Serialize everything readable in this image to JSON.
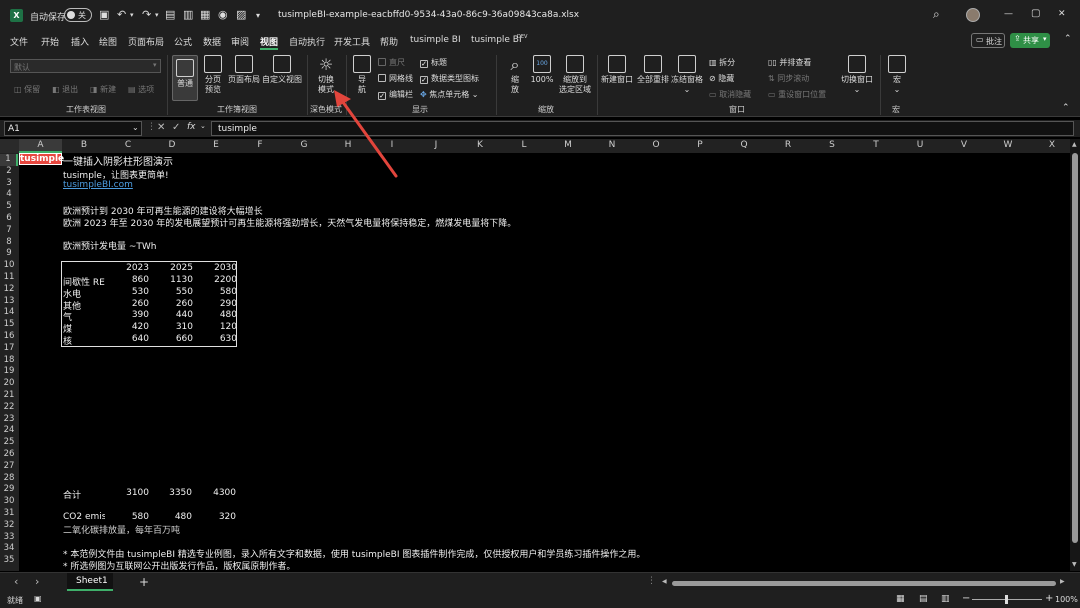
{
  "titlebar": {
    "autosave_label": "自动保存",
    "autosave_state": "关",
    "filename": "tusimpleBI-example-eacbffd0-9534-43a0-86c9-36a09843ca8a.xlsx",
    "win_min": "—",
    "win_max": "▢",
    "win_close": "✕"
  },
  "menu": {
    "items": [
      "文件",
      "开始",
      "插入",
      "绘图",
      "页面布局",
      "公式",
      "数据",
      "审阅",
      "视图",
      "自动执行",
      "开发工具",
      "帮助",
      "tusimple BI",
      "tusimple BI"
    ],
    "dev_badge": "DEV",
    "active_index": 8,
    "comment_label": "批注",
    "share_label": "共享"
  },
  "ribbon": {
    "sheetview": {
      "dropdown": "默认",
      "btn_keep": "保留",
      "btn_exit": "退出",
      "btn_new": "新建",
      "btn_options": "选项",
      "group": "工作表视图"
    },
    "workbook_view": {
      "normal": "普通",
      "page_break": [
        "分页",
        "预览"
      ],
      "page_layout": "页面布局",
      "custom": "自定义视图",
      "group": "工作簿视图"
    },
    "dark": {
      "toggle": [
        "切换",
        "模式"
      ],
      "group": "深色模式"
    },
    "show": {
      "nav": "导航",
      "ruler": "直尺",
      "gridlines": "网格线",
      "formula_bar": "编辑栏",
      "headings": "标题",
      "data_type_icons": "数据类型图标",
      "focus_cell": "焦点单元格",
      "group": "显示"
    },
    "zoom": {
      "zoom": [
        "缩",
        "放"
      ],
      "zoom_icon_text": "100",
      "hundred": "100%",
      "selection": [
        "缩放到",
        "选定区域"
      ],
      "group": "缩放"
    },
    "window": {
      "new_window": "新建窗口",
      "arrange_all": "全部重排",
      "freeze": "冻结窗格",
      "split": "拆分",
      "hide": "隐藏",
      "unhide": "取消隐藏",
      "side_by_side": "并排查看",
      "sync_scroll": "同步滚动",
      "reset_pos": "重设窗口位置",
      "switch": "切换窗口",
      "group": "窗口"
    },
    "macros": {
      "macro": "宏",
      "group": "宏"
    }
  },
  "formula_bar": {
    "name_box": "A1",
    "fx": "fx",
    "content": "tusimple"
  },
  "columns": [
    "A",
    "B",
    "C",
    "D",
    "E",
    "F",
    "G",
    "H",
    "I",
    "J",
    "K",
    "L",
    "M",
    "N",
    "O",
    "P",
    "Q",
    "R",
    "S",
    "T",
    "U",
    "V",
    "W",
    "X"
  ],
  "rows": [
    "1",
    "2",
    "3",
    "4",
    "5",
    "6",
    "7",
    "8",
    "9",
    "10",
    "11",
    "12",
    "13",
    "14",
    "15",
    "16",
    "17",
    "18",
    "19",
    "20",
    "21",
    "22",
    "23",
    "24",
    "25",
    "26",
    "27",
    "28",
    "29",
    "30",
    "31",
    "32",
    "33",
    "34",
    "35"
  ],
  "sheet": {
    "a1": "tusimple",
    "b1": "一键插入阴影柱形图演示",
    "b2": "tusimple，让图表更简单!",
    "b3": "tusimpleBI.com",
    "b5": "欧洲预计到 2030 年可再生能源的建设将大幅增长",
    "b6": "欧洲 2023 年至 2030 年的发电展望预计可再生能源将强劲增长，天然气发电量将保持稳定，燃煤发电量将下降。",
    "b8": "欧洲预计发电量 ~TWh",
    "table": {
      "years": [
        "2023",
        "2025",
        "2030"
      ],
      "rows": [
        {
          "label": "间歇性 RE",
          "values": [
            "860",
            "1130",
            "2200"
          ]
        },
        {
          "label": "水电",
          "values": [
            "530",
            "550",
            "580"
          ]
        },
        {
          "label": "其他",
          "values": [
            "260",
            "260",
            "290"
          ]
        },
        {
          "label": "气",
          "values": [
            "390",
            "440",
            "480"
          ]
        },
        {
          "label": "煤",
          "values": [
            "420",
            "310",
            "120"
          ]
        },
        {
          "label": "核",
          "values": [
            "640",
            "660",
            "630"
          ]
        }
      ]
    },
    "total": {
      "label": "合计",
      "values": [
        "3100",
        "3350",
        "4300"
      ]
    },
    "co2": {
      "label": "CO2 emis",
      "values": [
        "580",
        "480",
        "320"
      ]
    },
    "co2_note": "二氧化碳排放量，每年百万吨",
    "note1": "* 本范例文件由 tusimpleBI 精选专业例图，录入所有文字和数据，使用 tusimpleBI 图表插件制作完成，仅供授权用户和学员练习插件操作之用。",
    "note2": "* 所选例图为互联网公开出版发行作品，版权属原制作者。"
  },
  "tabs": {
    "sheet1": "Sheet1",
    "add": "+",
    "prev": "‹",
    "next": "›"
  },
  "status": {
    "ready": "就绪",
    "zoom": "100%"
  },
  "colors": {
    "accent_red": "#e8473f",
    "link": "#4d9de0",
    "share_green": "#2f8f46",
    "arrow": "#e2453c"
  }
}
